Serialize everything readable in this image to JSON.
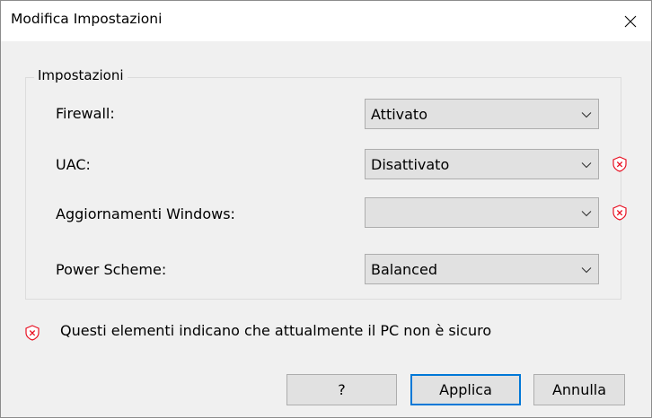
{
  "window": {
    "title": "Modifica Impostazioni"
  },
  "group": {
    "title": "Impostazioni"
  },
  "settings": [
    {
      "label": "Firewall:",
      "value": "Attivato",
      "warning": false
    },
    {
      "label": "UAC:",
      "value": "Disattivato",
      "warning": true
    },
    {
      "label": "Aggiornamenti Windows:",
      "value": "",
      "warning": true
    },
    {
      "label": "Power Scheme:",
      "value": "Balanced",
      "warning": false
    }
  ],
  "info": {
    "text": "Questi elementi indicano che attualmente il PC non è sicuro"
  },
  "buttons": {
    "help": "?",
    "apply": "Applica",
    "cancel": "Annulla"
  },
  "colors": {
    "warning": "#e81123",
    "accent": "#0078d7"
  }
}
